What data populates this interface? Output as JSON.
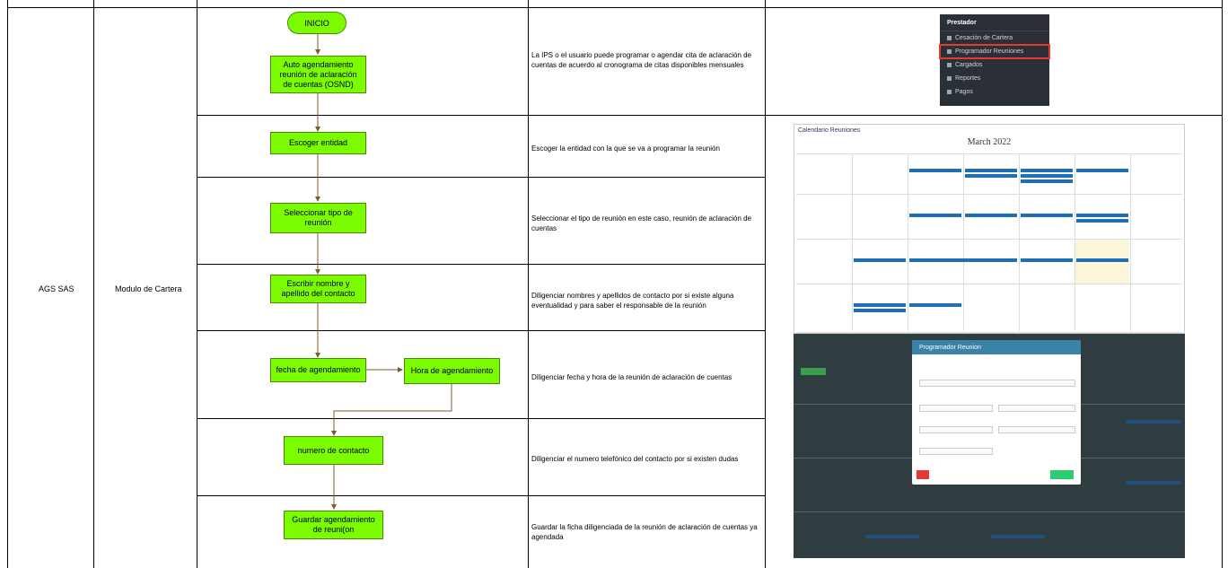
{
  "columns": {
    "company": "AGS SAS",
    "module": "Modulo de Cartera"
  },
  "flow": {
    "start": "INICIO",
    "step1": "Auto agendamiento reunión de aclaración de cuentas (OSND)",
    "step2": "Escoger entidad",
    "step3": "Seleccionar tipo de reunión",
    "step4": "Escribir nombre y apellido del contacto",
    "step5a": "fecha de agendamiento",
    "step5b": "Hora de agendamiento",
    "step6": "numero de contacto",
    "step7": "Guardar agendamiento de reuni(on"
  },
  "descriptions": [
    "La IPS o el usuario puede programar o agendar cita de aclaración de cuentas de acuerdo al cronograma de citas disponibles mensuales",
    "Escoger la entidad con la que se va a programar la reunión",
    "Seleccionar el tipo de reunión en este caso, reunión de aclaración de cuentas",
    "Diligenciar nombres y apellidos de contacto por si existe alguna eventualidad y para saber el responsable de la reunión",
    "Diligenciar  fecha y hora de la reunión de aclaración de cuentas",
    "Diligenciar el numero telefónico del contacto por si existen dudas",
    "Guardar la ficha diligenciada de la reunión de aclaración de cuentas ya agendada"
  ],
  "screenshots": {
    "menu_title": "Prestador",
    "menu_items": [
      "Cesación de Cartera",
      "Programador Reuniones",
      "Cargados",
      "Reportes",
      "Pagos"
    ],
    "calendar_title": "Calendario Reuniones",
    "calendar_month": "March 2022",
    "modal_title": "Programador Reunion"
  },
  "colors": {
    "flow_box": "#7cfc00",
    "highlight": "#e53b2c",
    "event": "#1f6fb5"
  }
}
